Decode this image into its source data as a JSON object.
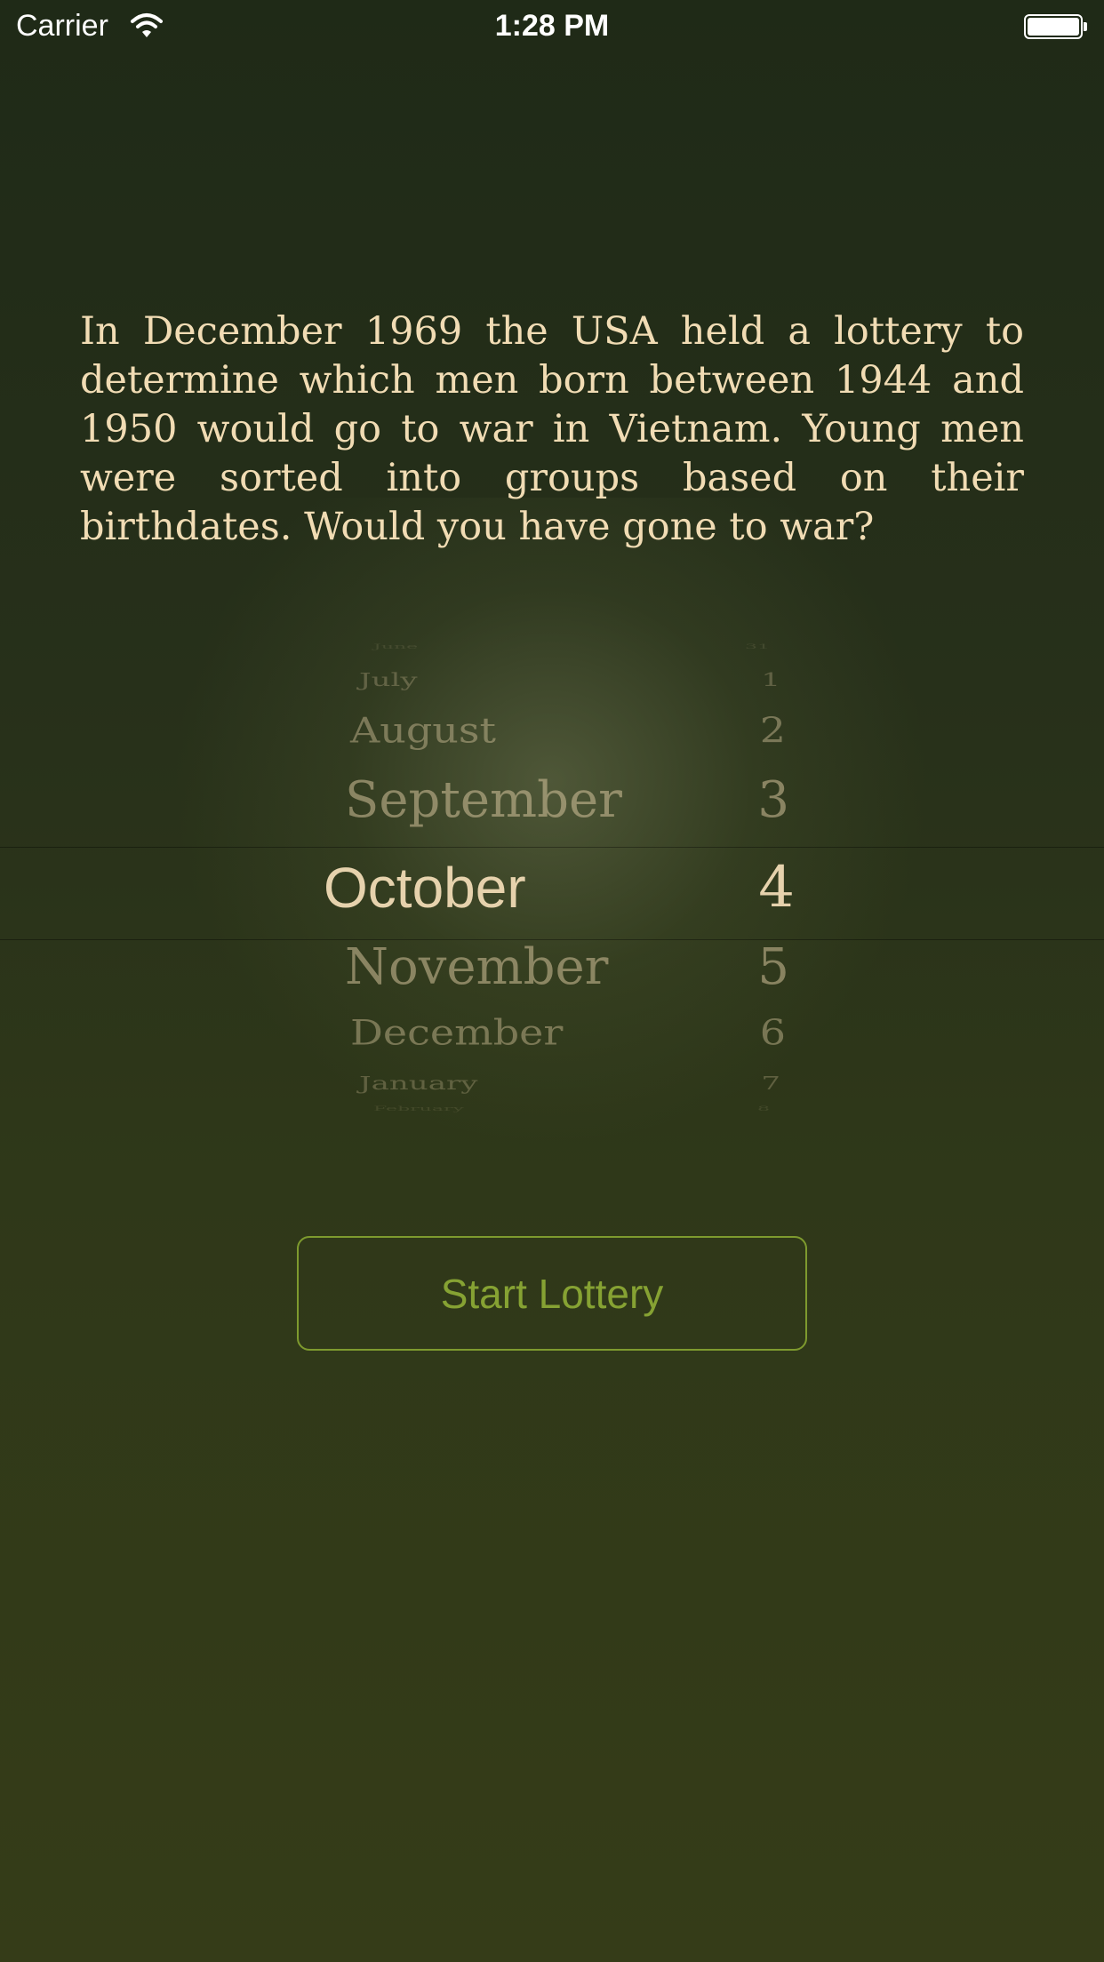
{
  "status_bar": {
    "carrier": "Carrier",
    "time": "1:28 PM",
    "wifi_icon": "wifi-icon",
    "battery_icon": "battery-icon"
  },
  "intro_text": "In December 1969 the USA held a lottery to determine which men born between 1944 and 1950 would go to war in Vietnam. Young men were sorted into groups based on their birthdates. Would you have gone to war?",
  "picker": {
    "rows": [
      {
        "month": "June",
        "day": "31"
      },
      {
        "month": "July",
        "day": "1"
      },
      {
        "month": "August",
        "day": "2"
      },
      {
        "month": "September",
        "day": "3"
      },
      {
        "month": "October",
        "day": "4"
      },
      {
        "month": "November",
        "day": "5"
      },
      {
        "month": "December",
        "day": "6"
      },
      {
        "month": "January",
        "day": "7"
      },
      {
        "month": "February",
        "day": "8"
      }
    ],
    "selected_month": "October",
    "selected_day": "4"
  },
  "start_button_label": "Start Lottery",
  "colors": {
    "text_cream": "#f1dcb4",
    "accent_green": "#86a233"
  }
}
